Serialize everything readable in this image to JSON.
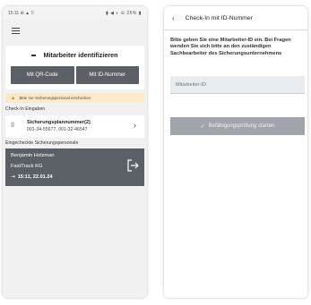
{
  "left": {
    "statusbar": {
      "time": "15:11",
      "left_icons": "⊕ ▲ ⠿",
      "right_icons": "▮ ◀ ◐ ⊖ 26% ▮"
    },
    "card": {
      "title": "Mitarbeiter identifizieren",
      "qr_button": "Mit QR-Code",
      "id_button": "Mit ID-Nummer"
    },
    "notice": "Bitte nur Sicherungspersonal einchecken",
    "checkin_label": "Check-In Eingaben",
    "plan": {
      "title": "Sicherungsplannummer(2)",
      "numbers": "001-34-55677, 001-32-46547"
    },
    "checked_label": "Eingecheckte Sicherungspersonale",
    "person": {
      "name": "Benjamin Holzman",
      "company": "FastTrack KG",
      "time": "15:11, 22.01.24"
    },
    "icons": {
      "menu": "hamburger-icon",
      "warning": "warning-icon",
      "plan": "document-icon",
      "chevron": "chevron-right-icon",
      "login": "login-icon",
      "exit": "logout-icon"
    },
    "colors": {
      "dark_button": "#5b6067",
      "notice_bg": "#fce9c9",
      "warning": "#e4801c"
    }
  },
  "right": {
    "header_title": "Check-In mit ID-Nummer",
    "description": "Bitte geben Sie eine Mitarbeiter-ID ein. Bei Fragen wenden Sie sich bitte an den zuständigen Sachbearbeiter des Sicherungsunternehmens",
    "input_placeholder": "Mitarbeiter-ID",
    "start_button": "Befähigungsprüfung starten",
    "colors": {
      "input_bg": "#e8ebef",
      "disabled_button": "#a1a4aa"
    }
  }
}
